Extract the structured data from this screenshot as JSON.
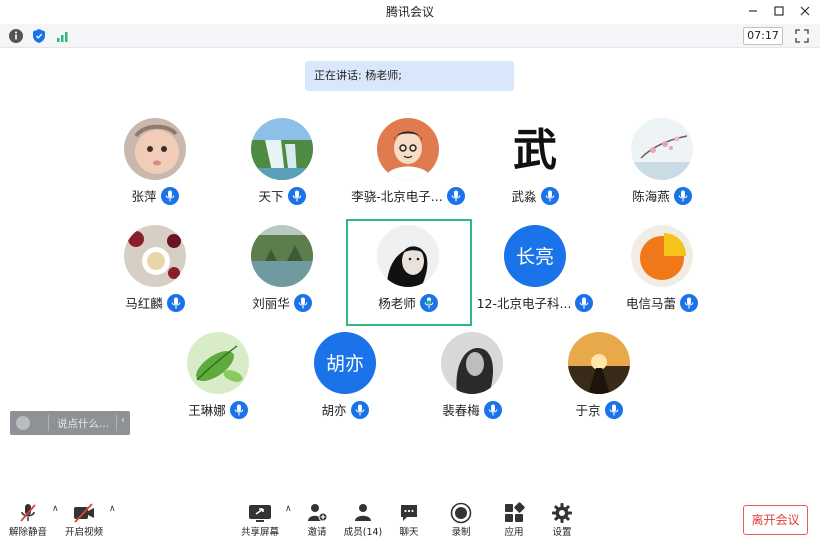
{
  "window": {
    "title": "腾讯会议"
  },
  "infobar": {
    "timer": "07:17"
  },
  "banner": {
    "speaking_text": "正在讲话: 杨老师;"
  },
  "participants": [
    {
      "name": "张萍",
      "avatar_kind": "baby-photo"
    },
    {
      "name": "天下",
      "avatar_kind": "waterfall-photo"
    },
    {
      "name": "李骁-北京电子...",
      "avatar_kind": "cartoon-man"
    },
    {
      "name": "武淼",
      "avatar_kind": "calligraphy",
      "avatar_text": "武"
    },
    {
      "name": "陈海燕",
      "avatar_kind": "blossom-painting"
    },
    {
      "name": "马红麟",
      "avatar_kind": "flowers-tea-photo"
    },
    {
      "name": "刘丽华",
      "avatar_kind": "lake-photo"
    },
    {
      "name": "杨老师",
      "avatar_kind": "woman-portrait",
      "speaking": true
    },
    {
      "name": "12-北京电子科...",
      "avatar_kind": "initials",
      "avatar_text": "长亮"
    },
    {
      "name": "电信马蕾",
      "avatar_kind": "pie-graphic"
    },
    {
      "name": "王琳娜",
      "avatar_kind": "green-leaf"
    },
    {
      "name": "胡亦",
      "avatar_kind": "initials",
      "avatar_text": "胡亦"
    },
    {
      "name": "裴春梅",
      "avatar_kind": "bw-portrait"
    },
    {
      "name": "于京",
      "avatar_kind": "sunset-photo"
    }
  ],
  "chat": {
    "placeholder": "说点什么..."
  },
  "toolbar": {
    "unmute": "解除静音",
    "start_video": "开启视频",
    "share_screen": "共享屏幕",
    "invite": "邀请",
    "members": "成员(14)",
    "chat": "聊天",
    "record": "录制",
    "apps": "应用",
    "settings": "设置",
    "leave": "离开会议"
  },
  "colors": {
    "accent": "#1a73e8",
    "speaking_border": "#2fba7b",
    "leave": "#e0403a",
    "banner": "#d9e7fb"
  }
}
